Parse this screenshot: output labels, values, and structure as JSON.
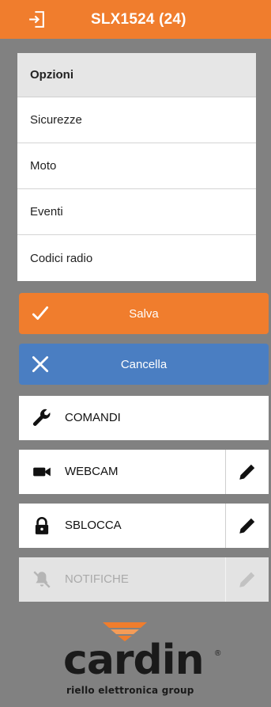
{
  "header": {
    "title": "SLX1524 (24)",
    "icon": "login-icon"
  },
  "menu": {
    "title": "Opzioni",
    "items": [
      {
        "label": "Sicurezze"
      },
      {
        "label": "Moto"
      },
      {
        "label": "Eventi"
      },
      {
        "label": "Codici radio"
      }
    ]
  },
  "actions": {
    "save_label": "Salva",
    "cancel_label": "Cancella"
  },
  "rows": {
    "comandi": {
      "label": "COMANDI",
      "icon": "wrench-icon"
    },
    "webcam": {
      "label": "WEBCAM",
      "icon": "videocam-icon",
      "edit_icon": "pencil-icon"
    },
    "sblocca": {
      "label": "SBLOCCA",
      "icon": "lock-icon",
      "edit_icon": "pencil-icon"
    },
    "notifiche": {
      "label": "NOTIFICHE",
      "icon": "bell-off-icon",
      "edit_icon": "pencil-icon",
      "disabled": true
    }
  },
  "logo": {
    "word": "cardin",
    "reg": "®",
    "tagline": "riello elettronica group"
  },
  "colors": {
    "brand": "#f07d2d",
    "cancel": "#4a7ec2",
    "background": "#818181"
  }
}
